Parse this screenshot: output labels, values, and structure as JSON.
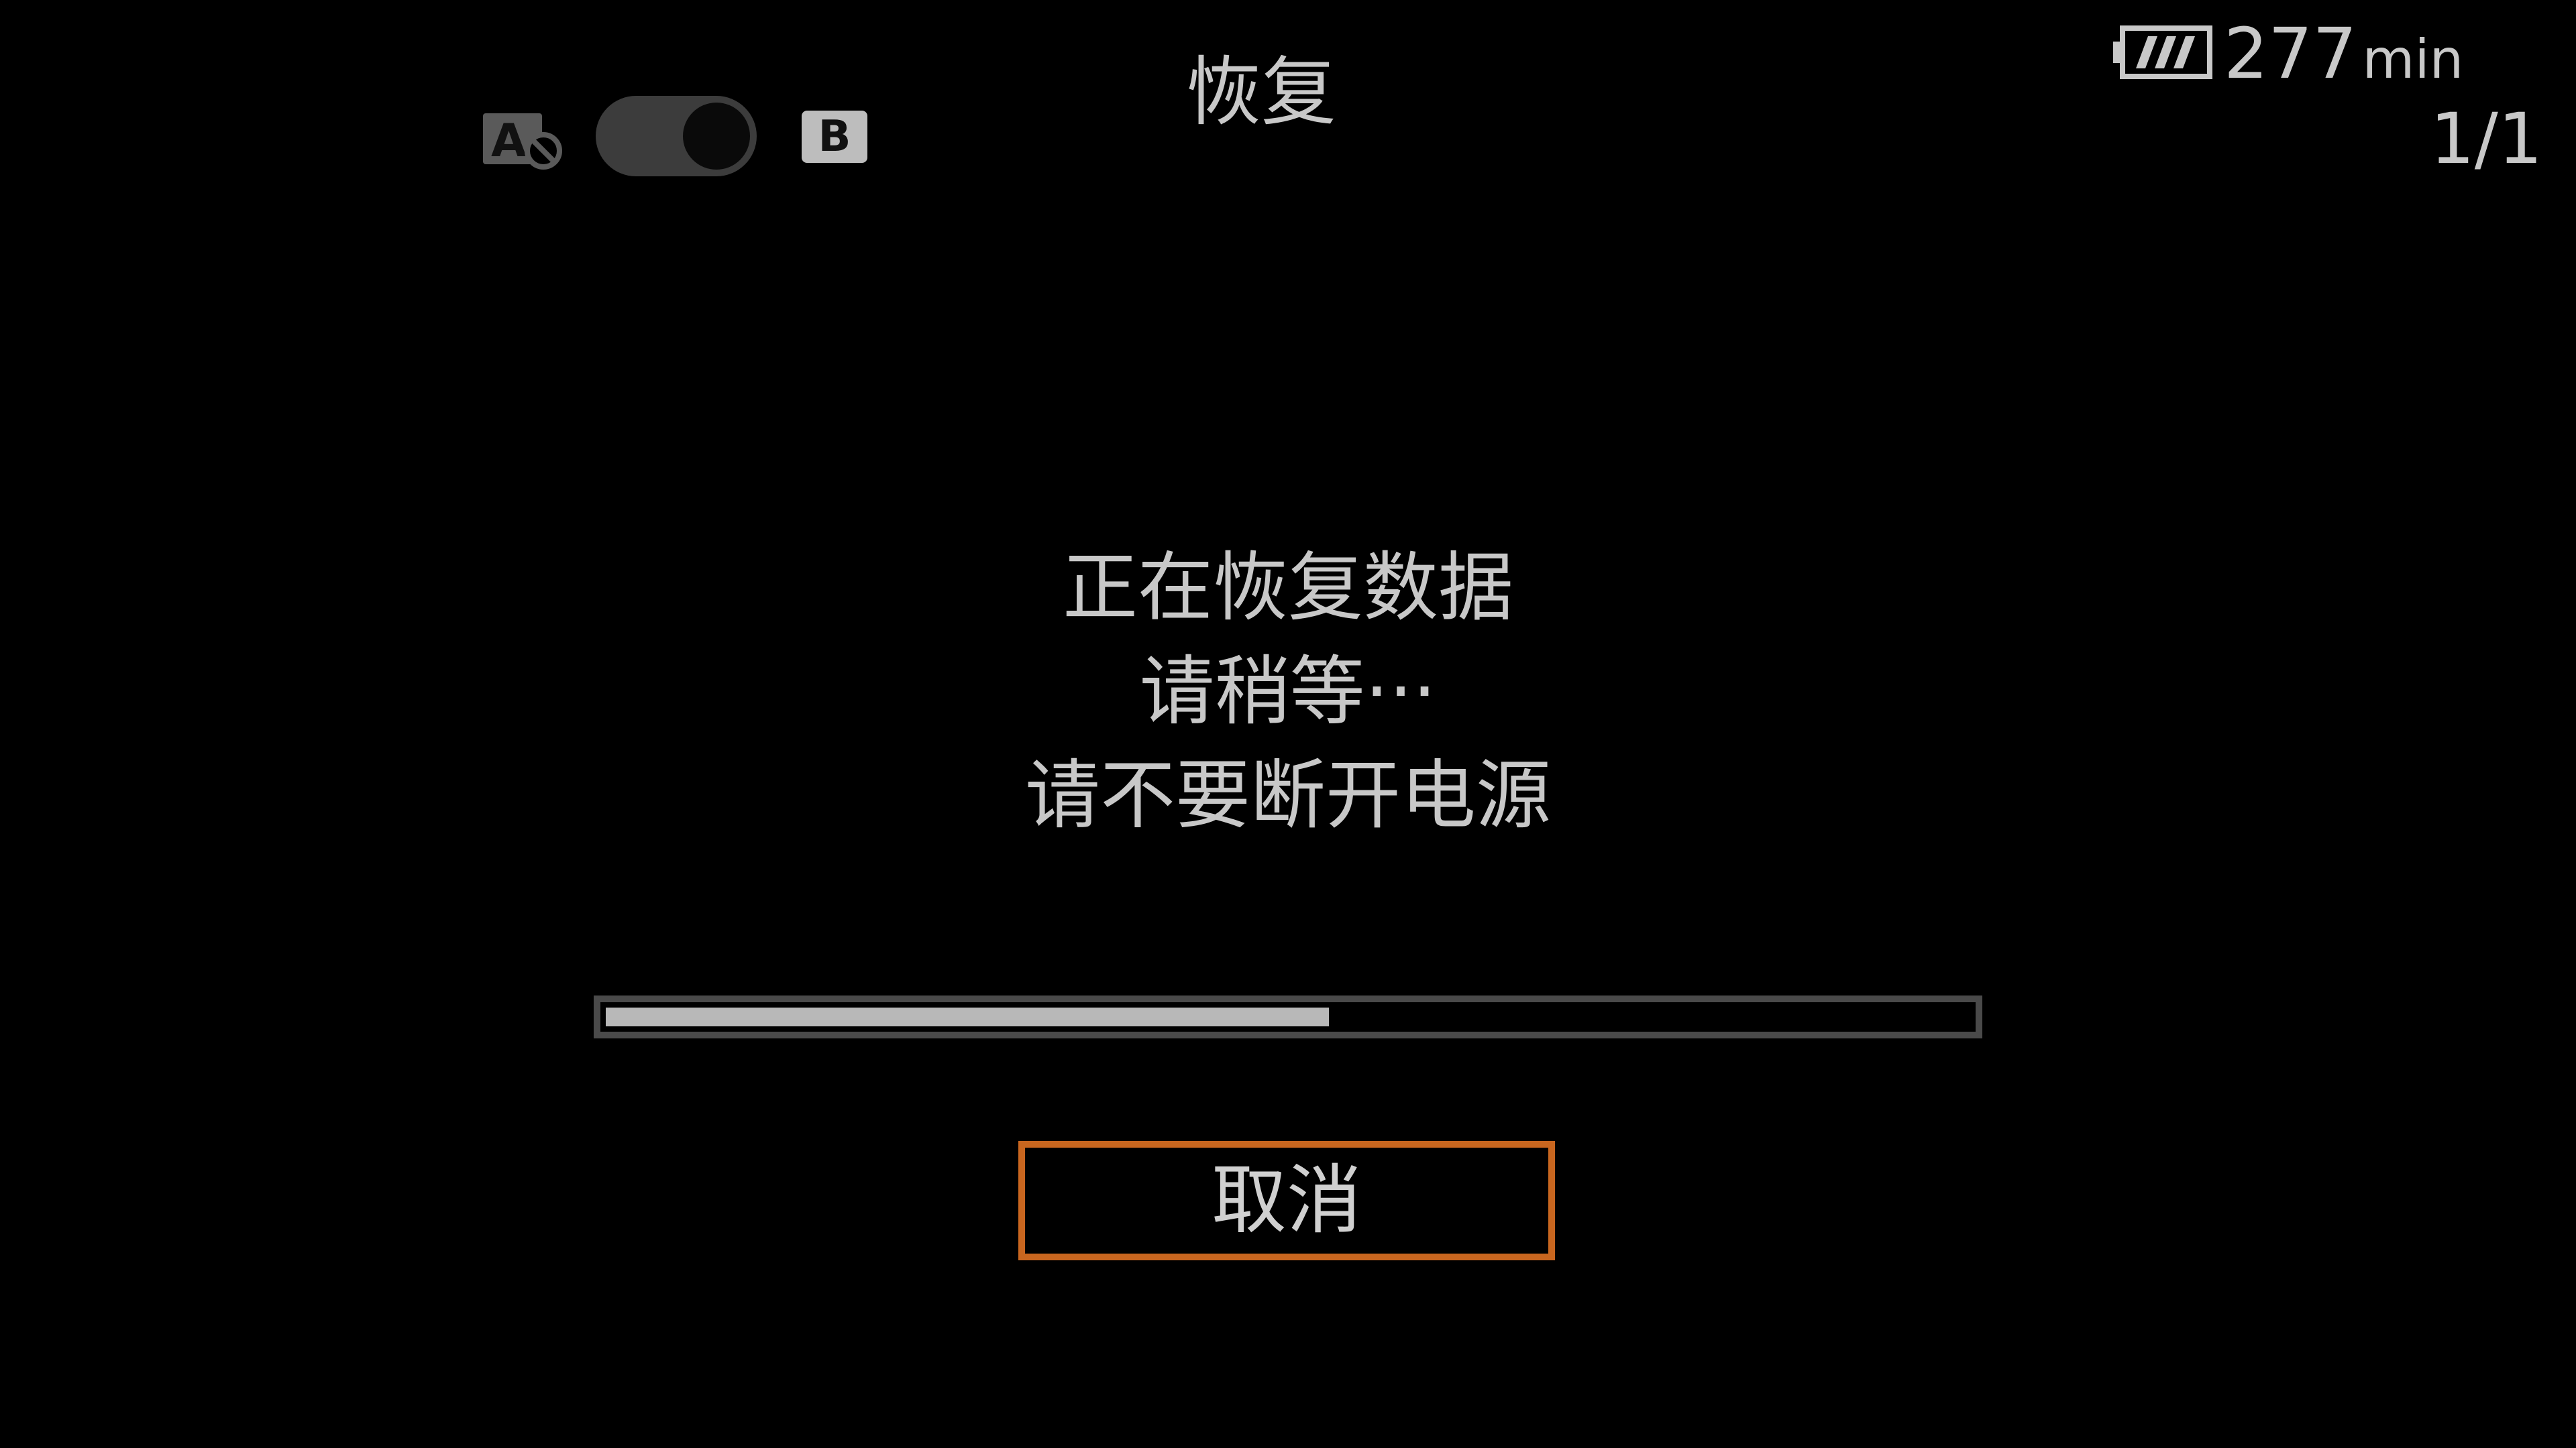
{
  "header": {
    "title": "恢复",
    "toggle_left_icon": "a-cancel-icon",
    "toggle_right_label": "B",
    "toggle_state": "on"
  },
  "status": {
    "battery_icon": "battery-full-icon",
    "battery_time": "277",
    "battery_unit": "min",
    "page_indicator": "1/1"
  },
  "message": {
    "line1": "正在恢复数据",
    "line2": "请稍等···",
    "line3": "请不要断开电源"
  },
  "progress": {
    "value": 0.53
  },
  "actions": {
    "cancel_label": "取消"
  },
  "colors": {
    "background": "#000000",
    "text": "#c8c8c8",
    "focus_border": "#c8661f",
    "progress_fill": "#b8b8b8"
  }
}
